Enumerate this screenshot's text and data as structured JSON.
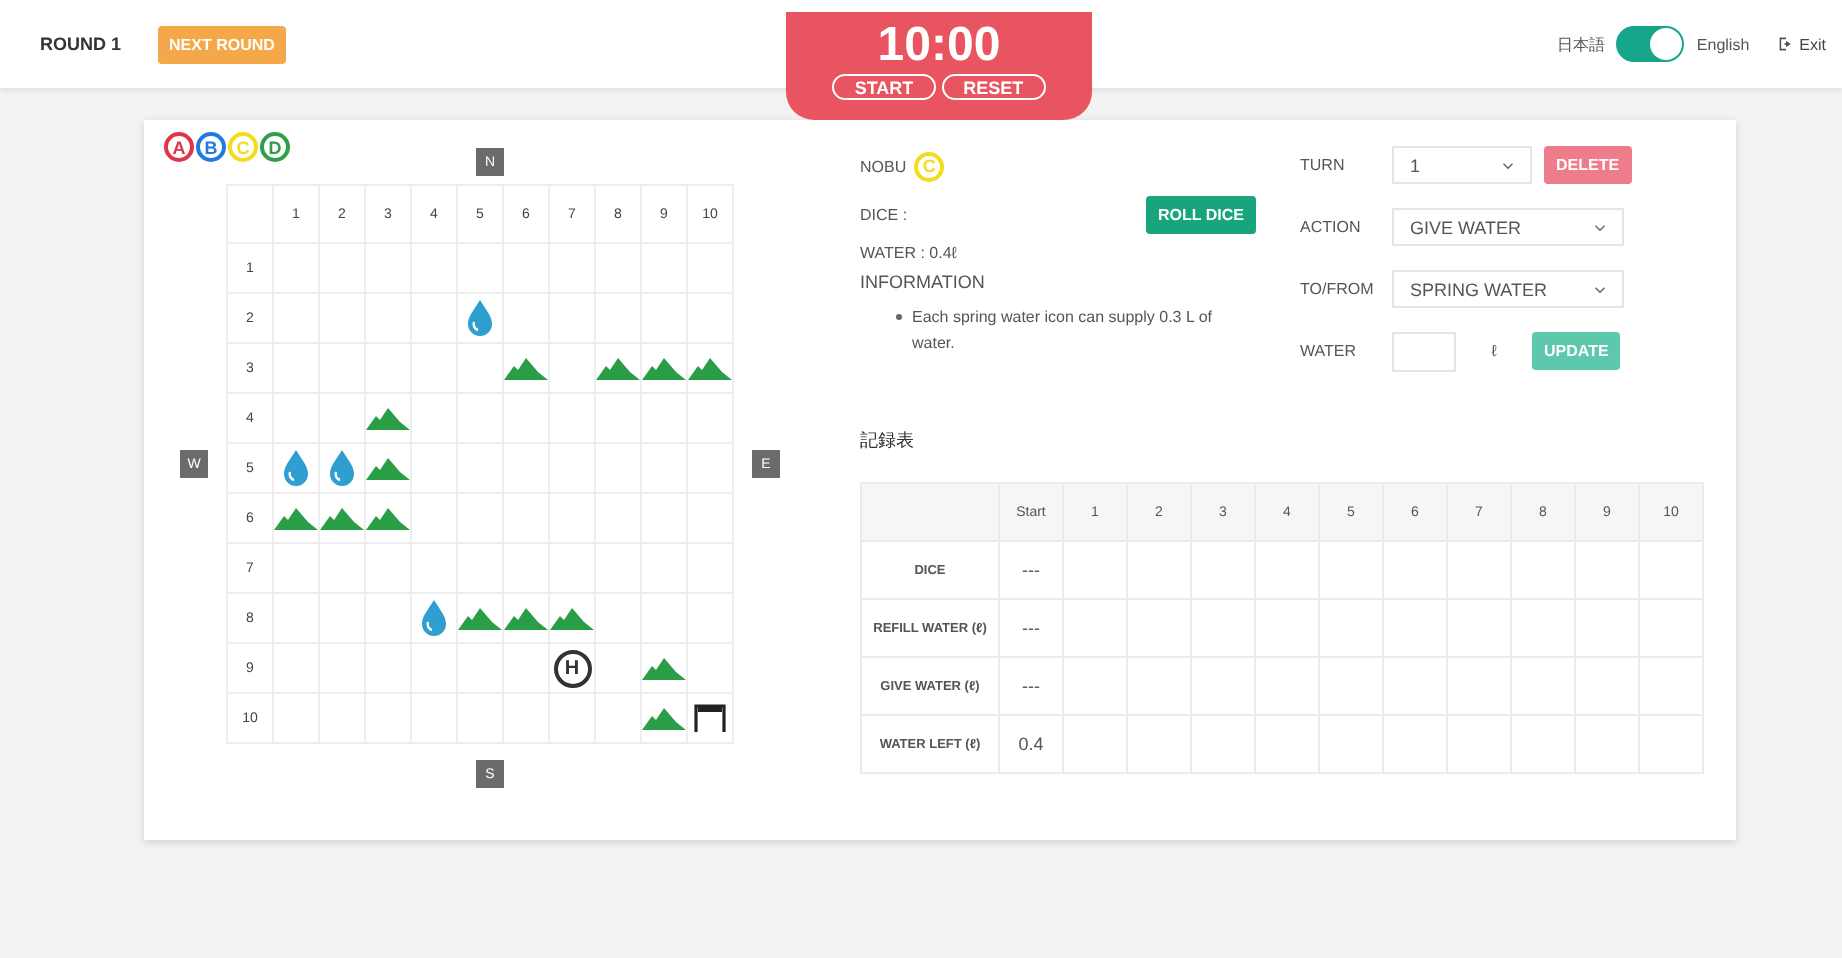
{
  "header": {
    "round": "ROUND 1",
    "next_round": "NEXT ROUND",
    "timer": "10:00",
    "start": "START",
    "reset": "RESET",
    "lang_left": "日本語",
    "lang_toggle_on": true,
    "lang_right": "English",
    "exit": "Exit"
  },
  "legend": [
    {
      "label": "A",
      "color": "#e0344a"
    },
    {
      "label": "B",
      "color": "#1f7be0"
    },
    {
      "label": "C",
      "color": "#f2dc1c"
    },
    {
      "label": "D",
      "color": "#2e9e48"
    }
  ],
  "compass": {
    "north": "N",
    "west": "W",
    "east": "E",
    "south": "S"
  },
  "grid": {
    "columns": [
      "1",
      "2",
      "3",
      "4",
      "5",
      "6",
      "7",
      "8",
      "9",
      "10"
    ],
    "rows": [
      {
        "label": "1",
        "cells": [
          {
            "kind": "blank"
          },
          {
            "kind": "blank"
          },
          {
            "kind": "blank"
          },
          {
            "kind": "blank"
          },
          {
            "kind": "blank"
          },
          {
            "kind": "blank"
          },
          {
            "kind": "blank"
          },
          {
            "kind": "blank"
          },
          {
            "kind": "blank"
          },
          {
            "kind": "blank"
          }
        ]
      },
      {
        "label": "2",
        "cells": [
          {
            "kind": "blank"
          },
          {
            "kind": "blank"
          },
          {
            "kind": "blank"
          },
          {
            "kind": "blank"
          },
          {
            "kind": "water"
          },
          {
            "kind": "blank"
          },
          {
            "kind": "blank"
          },
          {
            "kind": "blank"
          },
          {
            "kind": "blank"
          },
          {
            "kind": "blank"
          }
        ]
      },
      {
        "label": "3",
        "cells": [
          {
            "kind": "blank"
          },
          {
            "kind": "blank"
          },
          {
            "kind": "blank"
          },
          {
            "kind": "blank"
          },
          {
            "kind": "blank"
          },
          {
            "kind": "mountain"
          },
          {
            "kind": "blank"
          },
          {
            "kind": "mountain"
          },
          {
            "kind": "mountain"
          },
          {
            "kind": "mountain"
          }
        ]
      },
      {
        "label": "4",
        "cells": [
          {
            "kind": "blank"
          },
          {
            "kind": "blank"
          },
          {
            "kind": "mountain"
          },
          {
            "kind": "blank"
          },
          {
            "kind": "blank"
          },
          {
            "kind": "blank"
          },
          {
            "kind": "blank"
          },
          {
            "kind": "blank"
          },
          {
            "kind": "blank"
          },
          {
            "kind": "blank"
          }
        ]
      },
      {
        "label": "5",
        "cells": [
          {
            "kind": "water"
          },
          {
            "kind": "water"
          },
          {
            "kind": "mountain"
          },
          {
            "kind": "blank"
          },
          {
            "kind": "blank"
          },
          {
            "kind": "blank"
          },
          {
            "kind": "blank"
          },
          {
            "kind": "blank"
          },
          {
            "kind": "blank"
          },
          {
            "kind": "blank"
          }
        ]
      },
      {
        "label": "6",
        "cells": [
          {
            "kind": "mountain"
          },
          {
            "kind": "mountain"
          },
          {
            "kind": "mountain"
          },
          {
            "kind": "blank"
          },
          {
            "kind": "blank"
          },
          {
            "kind": "blank"
          },
          {
            "kind": "blank"
          },
          {
            "kind": "blank"
          },
          {
            "kind": "blank"
          },
          {
            "kind": "blank"
          }
        ]
      },
      {
        "label": "7",
        "cells": [
          {
            "kind": "blank"
          },
          {
            "kind": "blank"
          },
          {
            "kind": "blank"
          },
          {
            "kind": "blank"
          },
          {
            "kind": "blank"
          },
          {
            "kind": "blank"
          },
          {
            "kind": "blank"
          },
          {
            "kind": "blank"
          },
          {
            "kind": "blank"
          },
          {
            "kind": "blank"
          }
        ]
      },
      {
        "label": "8",
        "cells": [
          {
            "kind": "blank"
          },
          {
            "kind": "blank"
          },
          {
            "kind": "blank"
          },
          {
            "kind": "water"
          },
          {
            "kind": "mountain"
          },
          {
            "kind": "mountain"
          },
          {
            "kind": "mountain"
          },
          {
            "kind": "blank"
          },
          {
            "kind": "blank"
          },
          {
            "kind": "blank"
          }
        ]
      },
      {
        "label": "9",
        "cells": [
          {
            "kind": "blank"
          },
          {
            "kind": "blank"
          },
          {
            "kind": "blank"
          },
          {
            "kind": "blank"
          },
          {
            "kind": "blank"
          },
          {
            "kind": "blank"
          },
          {
            "kind": "home"
          },
          {
            "kind": "blank"
          },
          {
            "kind": "mountain"
          },
          {
            "kind": "blank"
          }
        ]
      },
      {
        "label": "10",
        "cells": [
          {
            "kind": "blank"
          },
          {
            "kind": "blank"
          },
          {
            "kind": "blank"
          },
          {
            "kind": "blank"
          },
          {
            "kind": "blank"
          },
          {
            "kind": "blank"
          },
          {
            "kind": "blank"
          },
          {
            "kind": "blank"
          },
          {
            "kind": "mountain"
          },
          {
            "kind": "goal"
          }
        ]
      }
    ],
    "home_label": "H"
  },
  "player": {
    "name": "NOBU",
    "badge": {
      "label": "C",
      "color": "#f2dc1c"
    }
  },
  "dice_label": "DICE :",
  "roll_dice": "ROLL DICE",
  "water": "WATER :  0.4ℓ",
  "information_title": "INFORMATION",
  "information": [
    "Each spring water icon can supply 0.3 L of water."
  ],
  "form": {
    "turn_label": "TURN",
    "turn_value": "1",
    "delete": "DELETE",
    "action_label": "ACTION",
    "action_value": "GIVE WATER",
    "tofrom_label": "TO/FROM",
    "tofrom_value": "SPRING WATER",
    "water_label": "WATER",
    "unit": "ℓ",
    "update": "UPDATE"
  },
  "record_title": "記録表",
  "record": {
    "columns": [
      "Start",
      "1",
      "2",
      "3",
      "4",
      "5",
      "6",
      "7",
      "8",
      "9",
      "10"
    ],
    "rows": [
      {
        "label": "DICE",
        "start": "---"
      },
      {
        "label": "REFILL WATER (ℓ)",
        "start": "---"
      },
      {
        "label": "GIVE WATER (ℓ)",
        "start": "---"
      },
      {
        "label": "WATER LEFT (ℓ)",
        "start": "0.4"
      }
    ]
  }
}
